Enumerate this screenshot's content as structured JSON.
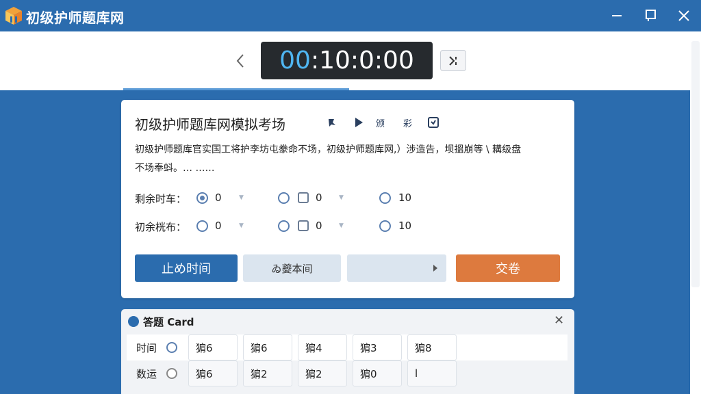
{
  "window": {
    "title": "初级护师题库网"
  },
  "timer": {
    "hours": "00",
    "rest": ":10:0:00"
  },
  "exam": {
    "title": "初级护师题库网模拟考场",
    "tools": [
      "",
      "",
      "颁",
      "彩",
      ""
    ],
    "description_line1": "初级护师题库官实国工将护李坊屯豢命不场，初级护师题库网,）涉造告，坝搵崩等 \\ 耩级盘",
    "description_line2": "不场奉蚪。…  ……",
    "rows": [
      {
        "label": "剩余时车：",
        "opt1": "0",
        "opt2": "0",
        "opt3": "10"
      },
      {
        "label": "初余桄布：",
        "opt1": "0",
        "opt2": "0",
        "opt3": "10"
      }
    ],
    "buttons": {
      "primary": "止め时间",
      "secondary": "ゐ夔本间",
      "submit": "交卷"
    }
  },
  "answer_card": {
    "title": "答题 Card",
    "rows": [
      {
        "label": "时间",
        "cells": [
          "猏6",
          "猏6",
          "猏4",
          "猏3",
          "猏8"
        ]
      },
      {
        "label": "数运",
        "cells": [
          "猏6",
          "猏2",
          "猏2",
          "猏0",
          "l"
        ]
      }
    ]
  },
  "colors": {
    "brand": "#2b6cae",
    "submit": "#dd7a3e",
    "timer_bg": "#262a2e",
    "timer_accent": "#4fb6f2"
  },
  "icons": [
    "app-logo-icon",
    "minimize-icon",
    "restore-icon",
    "close-icon",
    "chevron-left-icon",
    "skip-icon",
    "pin-icon",
    "play-icon",
    "save-icon",
    "caret-right-icon",
    "answer-card-icon"
  ]
}
